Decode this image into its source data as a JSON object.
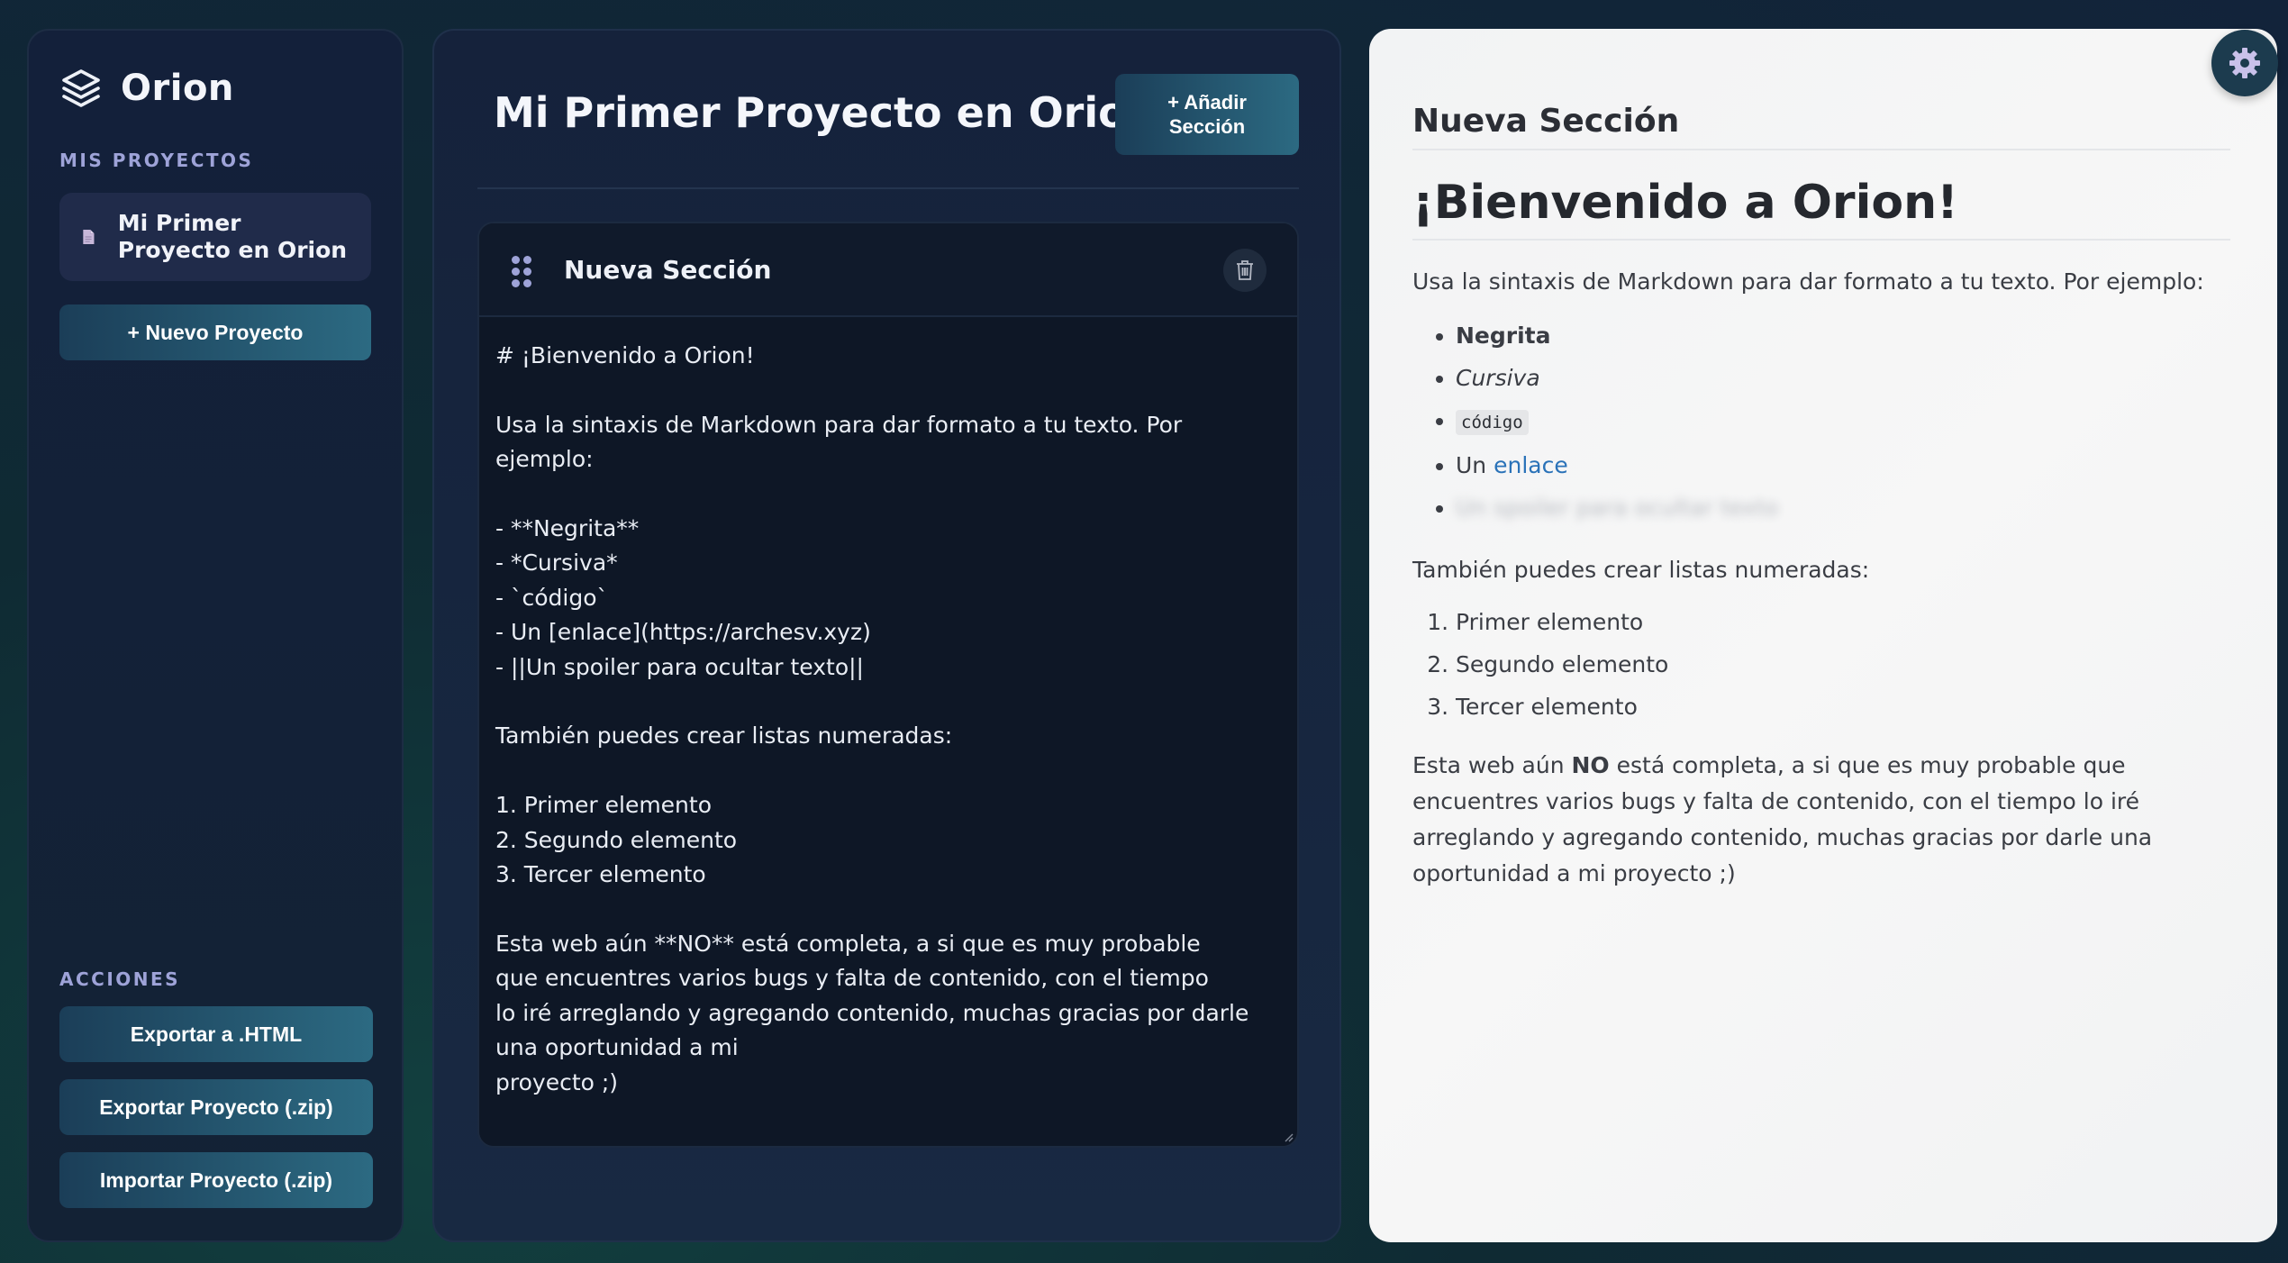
{
  "app": {
    "brand": "Orion",
    "accent": "#2c6a82"
  },
  "sidebar": {
    "projects_label": "MIS PROYECTOS",
    "projects": [
      {
        "name": "Mi Primer Proyecto en Orion",
        "icon": "document-icon"
      }
    ],
    "new_project_label": "+ Nuevo Proyecto",
    "actions_label": "ACCIONES",
    "actions": [
      "Exportar a .HTML",
      "Exportar Proyecto (.zip)",
      "Importar Proyecto (.zip)"
    ]
  },
  "editor": {
    "project_title": "Mi Primer Proyecto en Orion",
    "add_section_label": "+ Añadir Sección",
    "section": {
      "title": "Nueva Sección",
      "content": "# ¡Bienvenido a Orion!\n\nUsa la sintaxis de Markdown para dar formato a tu texto. Por ejemplo:\n\n- **Negrita**\n- *Cursiva*\n- `código`\n- Un [enlace](https://archesv.xyz)\n- ||Un spoiler para ocultar texto||\n\nTambién puedes crear listas numeradas:\n\n1. Primer elemento\n2. Segundo elemento\n3. Tercer elemento\n\nEsta web aún **NO** está completa, a si que es muy probable\nque encuentres varios bugs y falta de contenido, con el tiempo\nlo iré arreglando y agregando contenido, muchas gracias por darle una oportunidad a mi\nproyecto ;)"
    }
  },
  "preview": {
    "section_title": "Nueva Sección",
    "heading": "¡Bienvenido a Orion!",
    "intro": "Usa la sintaxis de Markdown para dar formato a tu texto. Por ejemplo:",
    "bullets": {
      "bold": "Negrita",
      "italic": "Cursiva",
      "code": "código",
      "link_prefix": "Un ",
      "link_text": "enlace",
      "spoiler": "Un spoiler para ocultar texto"
    },
    "numbered_intro": "También puedes crear listas numeradas:",
    "numbered": [
      "Primer elemento",
      "Segundo elemento",
      "Tercer elemento"
    ],
    "closing_before": "Esta web aún ",
    "closing_bold": "NO",
    "closing_after": " está completa, a si que es muy probable que encuentres varios bugs y falta de contenido, con el tiempo lo iré arreglando y agregando contenido, muchas gracias por darle una oportunidad a mi proyecto ;)"
  }
}
